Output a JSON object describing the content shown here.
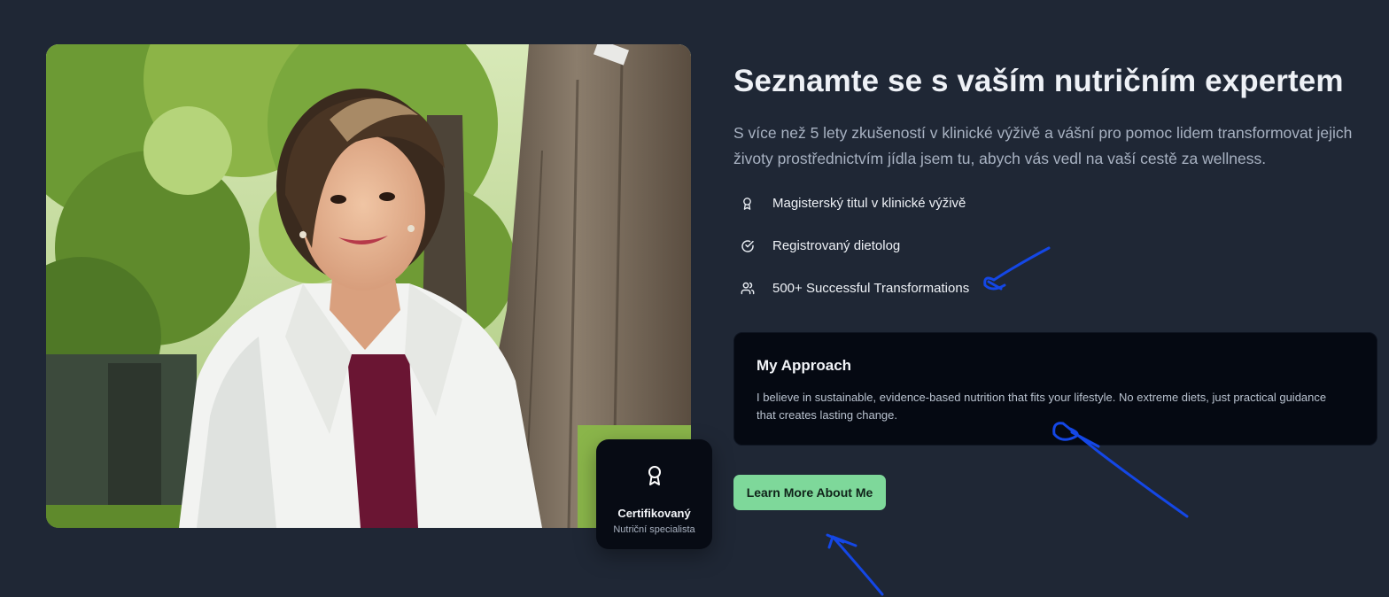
{
  "section": {
    "title": "Seznamte se s vaším nutričním expertem",
    "intro": "S více než 5 lety zkušeností v klinické výživě a vášní pro pomoc lidem transformovat jejich životy prostřednictvím jídla jsem tu, abych vás vedl na vaší cestě za wellness."
  },
  "credentials": [
    {
      "icon": "award-icon",
      "label": "Magisterský titul v klinické výživě"
    },
    {
      "icon": "check-circle-icon",
      "label": "Registrovaný dietolog"
    },
    {
      "icon": "users-icon",
      "label": "500+ Successful Transformations"
    }
  ],
  "approach": {
    "title": "My Approach",
    "text": "I believe in sustainable, evidence-based nutrition that fits your lifestyle. No extreme diets, just practical guidance that creates lasting change."
  },
  "cta": {
    "label": "Learn More About Me"
  },
  "badge": {
    "icon": "award-icon",
    "title": "Certifikovaný",
    "subtitle": "Nutriční specialista"
  },
  "colors": {
    "background": "#1f2735",
    "accent": "#7ed89a",
    "card": "#050912",
    "annotation": "#1447e6"
  }
}
